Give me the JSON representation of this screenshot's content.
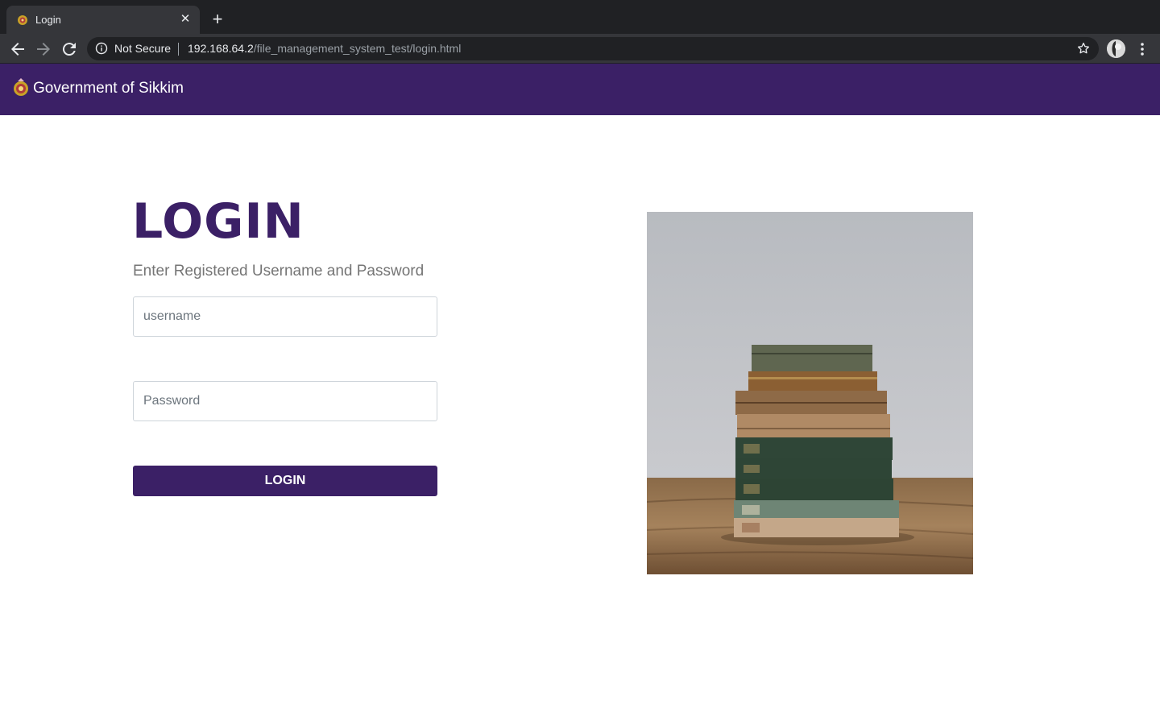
{
  "browser": {
    "tab_title": "Login",
    "tab_close": "✕",
    "new_tab": "+",
    "security_label": "Not Secure",
    "url_host": "192.168.64.2",
    "url_path": "/file_management_system_test/login.html"
  },
  "site": {
    "brand": "Government of Sikkim",
    "accent_color": "#3b2066"
  },
  "login": {
    "title": "LOGIN",
    "subtitle": "Enter Registered Username and Password",
    "username_placeholder": "username",
    "password_placeholder": "Password",
    "button_label": "LOGIN"
  },
  "image": {
    "subject": "stack-of-books-photo"
  }
}
